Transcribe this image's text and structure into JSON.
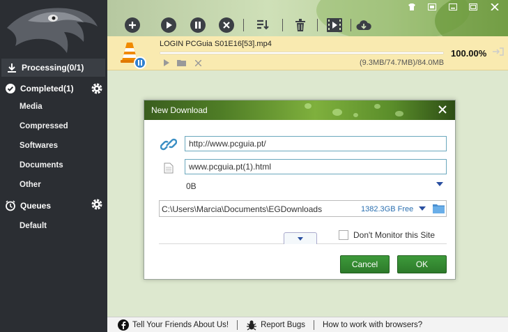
{
  "app": {
    "colors": {
      "accent": "#2d7a2a",
      "sidebar": "#2b2e33",
      "link": "#2a6fb0",
      "download_bar": "#f9eab0"
    }
  },
  "sidebar": {
    "processing": "Processing(0/1)",
    "completed": "Completed(1)",
    "completed_sub": [
      "Media",
      "Compressed",
      "Softwares",
      "Documents",
      "Other"
    ],
    "queues": "Queues",
    "queues_sub": [
      "Default"
    ]
  },
  "download": {
    "filename": "LOGIN PCGuia S01E16[53].mp4",
    "percent": "100.00%",
    "progress_value": 1.0,
    "size_info": "(9.3MB/74.7MB)/84.0MB"
  },
  "dialog": {
    "title": "New Download",
    "url": "http://www.pcguia.pt/",
    "filename": "www.pcguia.pt(1).html",
    "filesize": "0B",
    "path": "C:\\Users\\Marcia\\Documents\\EGDownloads",
    "free_space": "1382.3GB Free",
    "dont_monitor": "Don't Monitor this Site",
    "cancel": "Cancel",
    "ok": "OK"
  },
  "footer": {
    "friends": "Tell Your Friends About Us!",
    "bugs": "Report Bugs",
    "browsers": "How to work with browsers?"
  }
}
